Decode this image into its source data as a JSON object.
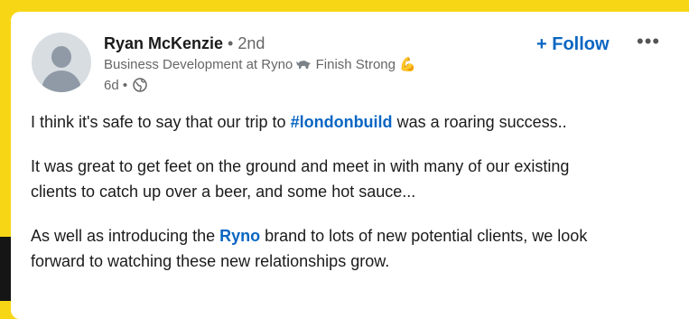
{
  "author": {
    "name": "Ryan McKenzie",
    "separator": " • ",
    "degree": "2nd",
    "headline_prefix": "Business Development at Ryno ",
    "headline_suffix": " Finish Strong ",
    "muscle_emoji": "💪",
    "time": "6d",
    "meta_separator": " • "
  },
  "actions": {
    "follow_label": "+ Follow",
    "more_label": "•••"
  },
  "post": {
    "p1_before": "I think it's safe to say that our trip to ",
    "p1_hashtag": "#londonbuild",
    "p1_after": " was a roaring success..",
    "p2_line1": "It was great to get feet on the ground and meet in with many of our existing",
    "p2_line2": "clients to catch up over a beer, and some hot sauce...",
    "p3_before": "As well as introducing the ",
    "p3_mention": "Ryno",
    "p3_after": " brand to lots of new potential clients, we look",
    "p3_line2": "forward to watching these new relationships grow."
  },
  "icons": {
    "globe": "globe-icon",
    "rhino": "rhino-icon",
    "muscle": "muscle-icon",
    "more": "more-icon"
  },
  "colors": {
    "background": "#f7d715",
    "link": "#0a66c2",
    "text": "#1b1b1b",
    "muted": "#666666"
  }
}
